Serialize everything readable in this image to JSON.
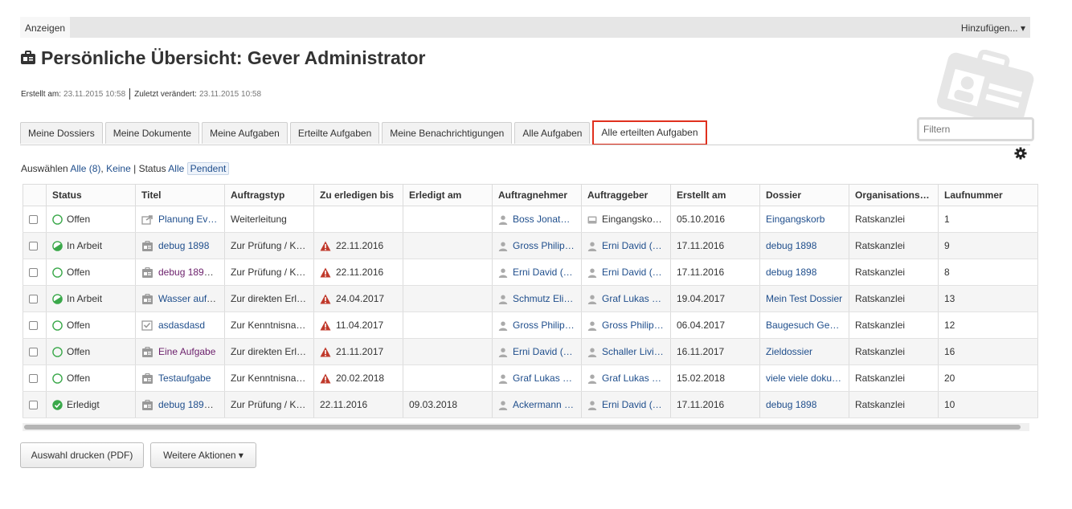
{
  "topbar": {
    "left_tab": "Anzeigen",
    "add_menu": "Hinzufügen... ▾"
  },
  "header": {
    "title": "Persönliche Übersicht: Gever Administrator",
    "created_label": "Erstellt am:",
    "created_value": "23.11.2015 10:58",
    "modified_label": "Zuletzt verändert:",
    "modified_value": "23.11.2015 10:58"
  },
  "filter": {
    "placeholder": "Filtern"
  },
  "tabs": [
    {
      "label": "Meine Dossiers"
    },
    {
      "label": "Meine Dokumente"
    },
    {
      "label": "Meine Aufgaben"
    },
    {
      "label": "Erteilte Aufgaben"
    },
    {
      "label": "Meine Benachrichtigungen"
    },
    {
      "label": "Alle Aufgaben"
    },
    {
      "label": "Alle erteilten Aufgaben"
    }
  ],
  "selection": {
    "prefix": "Auswählen",
    "all": "Alle (8)",
    "none": "Keine",
    "status_label": "Status",
    "status_all": "Alle",
    "status_pending": "Pendent"
  },
  "columns": [
    "Status",
    "Titel",
    "Auftragstyp",
    "Zu erledigen bis",
    "Erledigt am",
    "Auftragnehmer",
    "Auftraggeber",
    "Erstellt am",
    "Dossier",
    "Organisations…",
    "Laufnummer"
  ],
  "rows": [
    {
      "status": "Offen",
      "status_icon": "open-circle-icon",
      "title": "Planung Ev…",
      "title_icon": "forward-icon",
      "type": "Weiterleitung",
      "due": "",
      "due_warn": false,
      "done": "",
      "assignee": "Boss Jonat…",
      "assignee_icon": "person-icon",
      "issuer": "Eingangsko…",
      "issuer_icon": "inbox-icon",
      "issuer_link": false,
      "created": "05.10.2016",
      "dossier": "Eingangskorb",
      "org": "Ratskanzlei",
      "number": "1"
    },
    {
      "status": "In Arbeit",
      "status_icon": "in-progress-icon",
      "title": "debug 1898",
      "title_icon": "task-icon",
      "type": "Zur Prüfung / K…",
      "due": "22.11.2016",
      "due_warn": true,
      "done": "",
      "assignee": "Gross Philip…",
      "assignee_icon": "person-icon",
      "issuer": "Erni David (…",
      "issuer_icon": "person-icon",
      "issuer_link": true,
      "created": "17.11.2016",
      "dossier": "debug 1898",
      "org": "Ratskanzlei",
      "number": "9"
    },
    {
      "status": "Offen",
      "status_icon": "open-circle-icon",
      "title": "debug 1898…",
      "title_icon": "task-icon",
      "title_visited": true,
      "type": "Zur Prüfung / K…",
      "due": "22.11.2016",
      "due_warn": true,
      "done": "",
      "assignee": "Erni David (…",
      "assignee_icon": "person-icon",
      "issuer": "Erni David (…",
      "issuer_icon": "person-icon",
      "issuer_link": true,
      "created": "17.11.2016",
      "dossier": "debug 1898",
      "org": "Ratskanzlei",
      "number": "8"
    },
    {
      "status": "In Arbeit",
      "status_icon": "in-progress-icon",
      "title": "Wasser auff…",
      "title_icon": "task-icon",
      "type": "Zur direkten Erl…",
      "due": "24.04.2017",
      "due_warn": true,
      "done": "",
      "assignee": "Schmutz Eli…",
      "assignee_icon": "person-icon",
      "issuer": "Graf Lukas …",
      "issuer_icon": "person-icon",
      "issuer_link": true,
      "created": "19.04.2017",
      "dossier": "Mein Test Dossier",
      "org": "Ratskanzlei",
      "number": "13"
    },
    {
      "status": "Offen",
      "status_icon": "open-circle-icon",
      "title": "asdasdasd",
      "title_icon": "checklist-icon",
      "type": "Zur Kenntnisna…",
      "due": "11.04.2017",
      "due_warn": true,
      "done": "",
      "assignee": "Gross Philip…",
      "assignee_icon": "person-icon",
      "issuer": "Gross Philip…",
      "issuer_icon": "person-icon",
      "issuer_link": true,
      "created": "06.04.2017",
      "dossier": "Baugesuch Ge…",
      "org": "Ratskanzlei",
      "number": "12"
    },
    {
      "status": "Offen",
      "status_icon": "open-circle-icon",
      "title": "Eine Aufgabe",
      "title_icon": "task-icon",
      "title_visited": true,
      "type": "Zur direkten Erl…",
      "due": "21.11.2017",
      "due_warn": true,
      "done": "",
      "assignee": "Erni David (…",
      "assignee_icon": "person-icon",
      "issuer": "Schaller Livi…",
      "issuer_icon": "person-icon",
      "issuer_link": true,
      "created": "16.11.2017",
      "dossier": "Zieldossier",
      "org": "Ratskanzlei",
      "number": "16"
    },
    {
      "status": "Offen",
      "status_icon": "open-circle-icon",
      "title": "Testaufgabe",
      "title_icon": "task-icon",
      "type": "Zur Kenntnisna…",
      "due": "20.02.2018",
      "due_warn": true,
      "done": "",
      "assignee": "Graf Lukas …",
      "assignee_icon": "person-icon",
      "issuer": "Graf Lukas …",
      "issuer_icon": "person-icon",
      "issuer_link": true,
      "created": "15.02.2018",
      "dossier": "viele viele doku…",
      "org": "Ratskanzlei",
      "number": "20"
    },
    {
      "status": "Erledigt",
      "status_icon": "done-check-icon",
      "title": "debug 1898…",
      "title_icon": "task-icon",
      "type": "Zur Prüfung / K…",
      "due": "22.11.2016",
      "due_warn": false,
      "done": "09.03.2018",
      "assignee": "Ackermann …",
      "assignee_icon": "person-icon",
      "issuer": "Erni David (…",
      "issuer_icon": "person-icon",
      "issuer_link": true,
      "created": "17.11.2016",
      "dossier": "debug 1898",
      "org": "Ratskanzlei",
      "number": "10"
    }
  ],
  "buttons": {
    "print": "Auswahl drucken (PDF)",
    "more": "Weitere Aktionen ▾"
  },
  "colors": {
    "link": "#1f4e8c",
    "visited": "#6b1f6b",
    "active_tab_border": "#e0301e",
    "status_green": "#3aa84a",
    "warning_red": "#c0392b"
  }
}
